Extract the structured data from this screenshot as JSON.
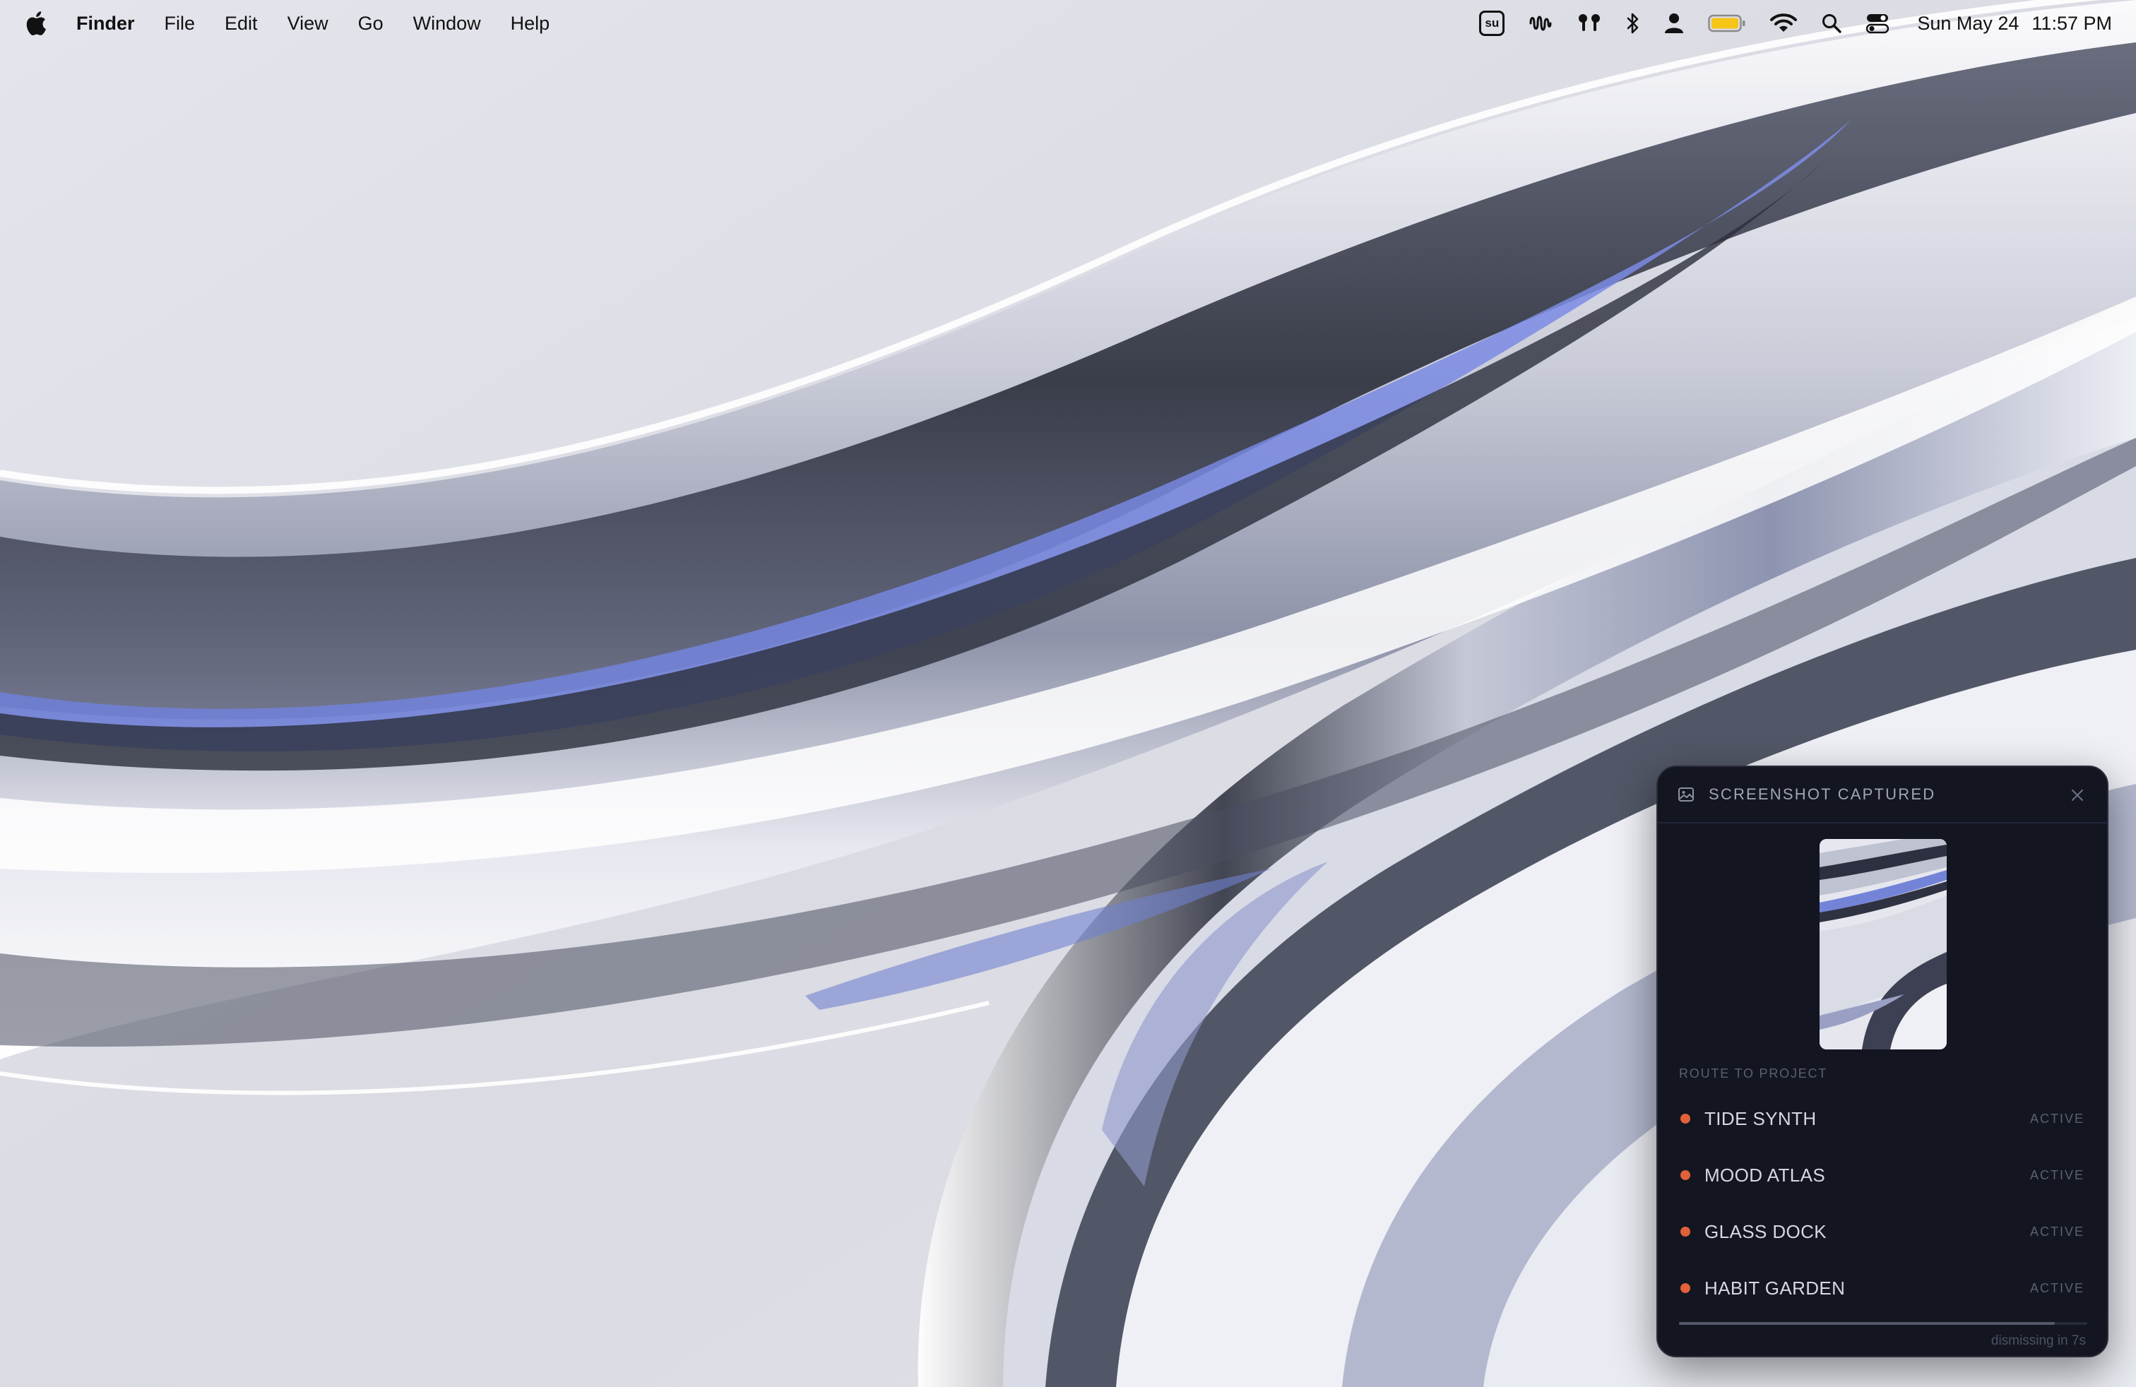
{
  "menubar": {
    "apple_icon": "apple-logo-icon",
    "app_name": "Finder",
    "menus": [
      "File",
      "Edit",
      "View",
      "Go",
      "Window",
      "Help"
    ],
    "status_icons": [
      "su-badge-icon",
      "audio-waveform-icon",
      "airpods-icon",
      "bluetooth-icon",
      "user-icon",
      "battery-icon",
      "wifi-icon",
      "search-icon",
      "control-center-icon"
    ],
    "su_badge_text": "su",
    "battery_color": "#f5c518",
    "date": "Sun May 24",
    "time": "11:57 PM"
  },
  "panel": {
    "header_icon": "image-icon",
    "title": "SCREENSHOT CAPTURED",
    "close_icon": "close-icon",
    "route_label": "ROUTE TO PROJECT",
    "projects": [
      {
        "name": "TIDE SYNTH",
        "status": "ACTIVE"
      },
      {
        "name": "MOOD ATLAS",
        "status": "ACTIVE"
      },
      {
        "name": "GLASS DOCK",
        "status": "ACTIVE"
      },
      {
        "name": "HABIT GARDEN",
        "status": "ACTIVE"
      }
    ],
    "dot_color": "#e0613a",
    "dismiss_progress": 0.92,
    "dismiss_text": "dismissing in 7s"
  }
}
